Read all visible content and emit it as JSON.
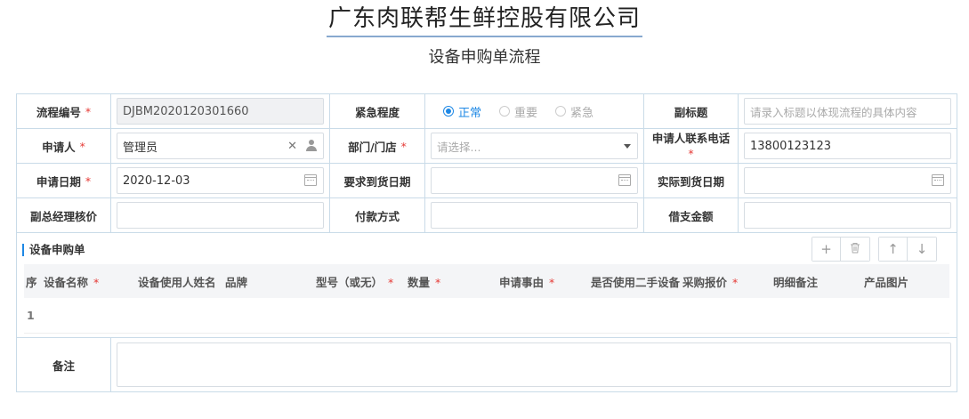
{
  "header": {
    "company": "广东肉联帮生鲜控股有限公司",
    "subtitle": "设备申购单流程"
  },
  "form": {
    "flow_no_label": "流程编号",
    "flow_no_value": "DJBM2020120301660",
    "urgency_label": "紧急程度",
    "urgency_options": [
      "正常",
      "重要",
      "紧急"
    ],
    "urgency_selected": "正常",
    "subtitle_label": "副标题",
    "subtitle_placeholder": "请录入标题以体现流程的具体内容",
    "applicant_label": "申请人",
    "applicant_value": "管理员",
    "dept_label": "部门/门店",
    "dept_placeholder": "请选择...",
    "phone_label": "申请人联系电话",
    "phone_value": "13800123123",
    "apply_date_label": "申请日期",
    "apply_date_value": "2020-12-03",
    "required_date_label": "要求到货日期",
    "required_date_value": "",
    "actual_date_label": "实际到货日期",
    "actual_date_value": "",
    "vp_review_label": "副总经理核价",
    "payment_label": "付款方式",
    "loan_label": "借支金额",
    "remark_label": "备注",
    "required_mark": "*"
  },
  "grid": {
    "title": "设备申购单",
    "toolbar": {
      "add": "+",
      "delete": "🗑",
      "up": "↑",
      "down": "↓"
    },
    "columns": [
      {
        "label": "序",
        "required": false
      },
      {
        "label": "设备名称",
        "required": true
      },
      {
        "label": "设备使用人姓名",
        "required": false
      },
      {
        "label": "品牌",
        "required": false
      },
      {
        "label": "型号（或无）",
        "required": true
      },
      {
        "label": "数量",
        "required": true
      },
      {
        "label": "申请事由",
        "required": true
      },
      {
        "label": "是否使用二手设备",
        "required": false
      },
      {
        "label": "采购报价",
        "required": true
      },
      {
        "label": "明细备注",
        "required": false
      },
      {
        "label": "产品图片",
        "required": false
      }
    ],
    "rows": [
      {
        "index": "1"
      }
    ]
  },
  "colors": {
    "accent": "#1e88e5",
    "required": "#e53935",
    "border": "#c9dbe8"
  }
}
